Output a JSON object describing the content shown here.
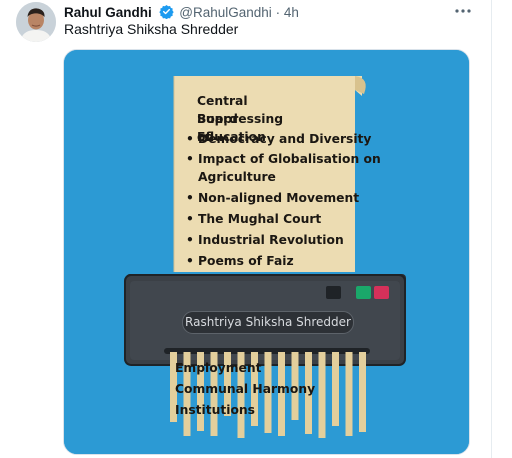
{
  "tweet": {
    "author_name": "Rahul Gandhi",
    "handle": "@RahulGandhi",
    "separator": "·",
    "time": "4h",
    "more_icon": "ellipsis-icon",
    "verified_icon": "verified-badge-icon",
    "text": "Rashtriya Shiksha Shredder"
  },
  "image": {
    "paper_title_line1": "Central Board of",
    "paper_title_line2": "Suppressing Education",
    "paper_items": [
      {
        "text": "Democracy and Diversity"
      },
      {
        "text": "Impact of Globalisation on"
      },
      {
        "text": "Agriculture",
        "continuation": true
      },
      {
        "text": "Non-aligned Movement"
      },
      {
        "text": "The Mughal Court"
      },
      {
        "text": "Industrial Revolution"
      },
      {
        "text": "Poems of Faiz"
      }
    ],
    "shredder_label": "Rashtriya Shiksha Shredder",
    "shredded_items": [
      "Employment",
      "Communal Harmony",
      "Institutions"
    ],
    "colors": {
      "background": "#2c9ad4",
      "paper": "#ecdcb2",
      "shredder": "#3b4046",
      "strip": "#e3cf9c",
      "light_green": "#1aa86a",
      "light_red": "#d6315a"
    }
  }
}
